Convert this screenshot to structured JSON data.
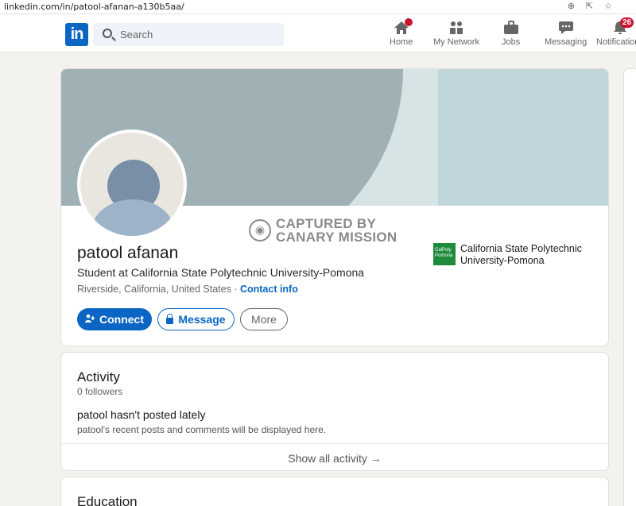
{
  "browser": {
    "url": "linkedin.com/in/patool-afanan-a130b5aa/",
    "icons": [
      "zoom-icon",
      "share-icon",
      "star-icon"
    ]
  },
  "nav": {
    "logo": "in",
    "search_placeholder": "Search",
    "items": [
      {
        "label": "Home",
        "icon": "home-icon"
      },
      {
        "label": "My Network",
        "icon": "network-icon"
      },
      {
        "label": "Jobs",
        "icon": "briefcase-icon"
      },
      {
        "label": "Messaging",
        "icon": "chat-icon"
      },
      {
        "label": "Notifications",
        "icon": "bell-icon",
        "badge": "26"
      }
    ]
  },
  "profile": {
    "name": "patool afanan",
    "headline": "Student at California State Polytechnic University-Pomona",
    "location": "Riverside, California, United States",
    "separator": " · ",
    "contact_label": "Contact info",
    "school_logo_text": "CalPoly Pomona",
    "school_name": "California State Polytechnic University-Pomona",
    "watermark_line1": "CAPTURED BY",
    "watermark_line2": "CANARY MISSION",
    "buttons": {
      "connect": "Connect",
      "message": "Message",
      "more": "More"
    }
  },
  "activity": {
    "title": "Activity",
    "followers": "0 followers",
    "heading": "patool hasn't posted lately",
    "subtext": "patool's recent posts and comments will be displayed here.",
    "show_all": "Show all activity →"
  },
  "education": {
    "title": "Education"
  },
  "colors": {
    "brand": "#0a66c2",
    "badge": "#cb112d",
    "page_bg": "#f4f2ee"
  }
}
